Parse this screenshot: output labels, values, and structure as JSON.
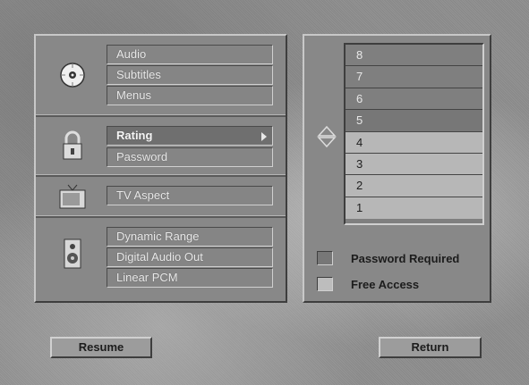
{
  "menu": {
    "audio_group": {
      "icon": "disc-icon",
      "items": [
        "Audio",
        "Subtitles",
        "Menus"
      ]
    },
    "security_group": {
      "icon": "padlock-icon",
      "items": [
        "Rating",
        "Password"
      ]
    },
    "display_group": {
      "icon": "tv-icon",
      "items": [
        "TV Aspect"
      ]
    },
    "sound_group": {
      "icon": "speaker-icon",
      "items": [
        "Dynamic Range",
        "Digital Audio Out",
        "Linear PCM"
      ]
    }
  },
  "rating_panel": {
    "levels": [
      "8",
      "7",
      "6",
      "5",
      "4",
      "3",
      "2",
      "1"
    ],
    "selected_level": "4",
    "options": [
      "Password Required",
      "Free Access"
    ]
  },
  "buttons": {
    "resume": "Resume",
    "return": "Return"
  }
}
